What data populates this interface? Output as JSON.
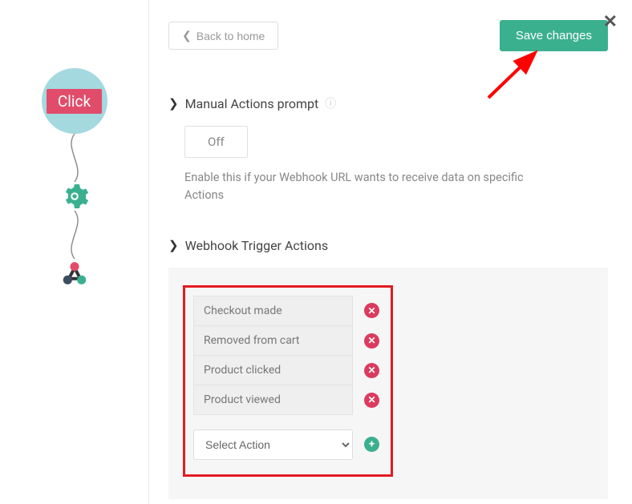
{
  "sidebar": {
    "click_label": "Click"
  },
  "toolbar": {
    "back_label": "Back to home",
    "save_label": "Save changes"
  },
  "sections": {
    "manual_actions": {
      "title": "Manual Actions prompt",
      "toggle_label": "Off",
      "helper": "Enable this if your Webhook URL wants to receive data on specific Actions"
    },
    "trigger_actions": {
      "title": "Webhook Trigger Actions",
      "items": [
        {
          "label": "Checkout made"
        },
        {
          "label": "Removed from cart"
        },
        {
          "label": "Product clicked"
        },
        {
          "label": "Product viewed"
        }
      ],
      "select_placeholder": "Select Action"
    }
  },
  "colors": {
    "accent": "#3bb08f",
    "danger": "#da3b5e",
    "highlight_box": "#e31b23"
  }
}
